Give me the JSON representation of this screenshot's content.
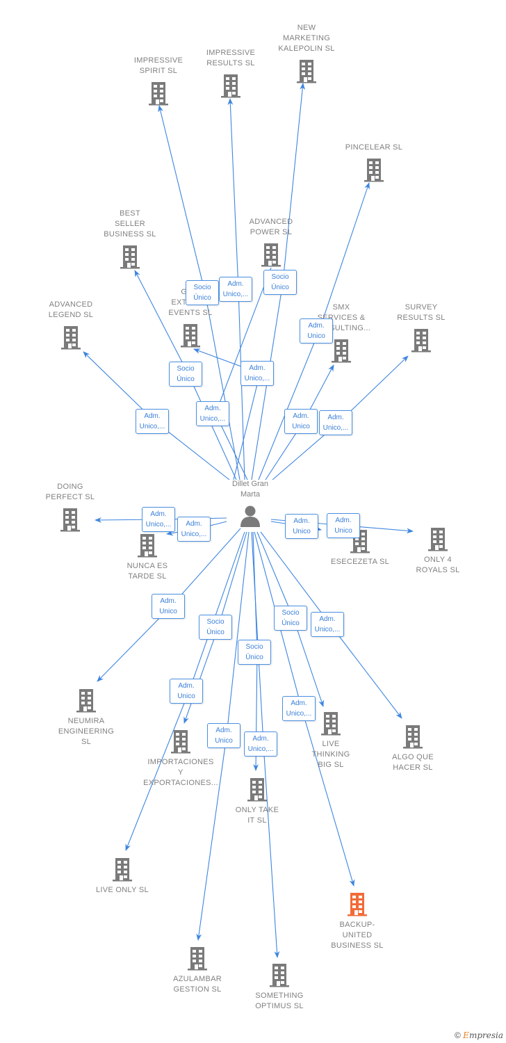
{
  "center": {
    "name": "Dillet Gran\nMarta",
    "icon": "person-icon"
  },
  "colors": {
    "edge": "#3d85e0",
    "building": "#7a7a7a",
    "highlight": "#f26b38",
    "label_text": "#808080"
  },
  "companies": [
    {
      "id": "impressive-spirit",
      "name": "IMPRESSIVE\nSPIRIT  SL",
      "role": "Socio\nÚnico"
    },
    {
      "id": "impressive-results",
      "name": "IMPRESSIVE\nRESULTS  SL",
      "role": "Adm.\nUnico,..."
    },
    {
      "id": "new-marketing",
      "name": "NEW\nMARKETING\nKALEPOLIN  SL",
      "role": "Socio\nÚnico"
    },
    {
      "id": "pincelear",
      "name": "PINCELEAR  SL",
      "role": "Adm.\nUnico"
    },
    {
      "id": "best-seller",
      "name": "BEST\nSELLER\nBUSINESS  SL",
      "role": "Socio\nÚnico"
    },
    {
      "id": "advanced-power",
      "name": "ADVANCED\nPOWER  SL",
      "role": "Adm.\nUnico,..."
    },
    {
      "id": "green-extreme",
      "name": "GR...\nEXTREME\nEVENTS  SL",
      "role": "Adm.\nUnico,..."
    },
    {
      "id": "advanced-legend",
      "name": "ADVANCED\nLEGEND  SL",
      "role": "Adm.\nUnico,..."
    },
    {
      "id": "smx",
      "name": "SMX\nSERVICES &\nCONSULTING...",
      "role": "Adm.\nUnico"
    },
    {
      "id": "survey-results",
      "name": "SURVEY\nRESULTS  SL",
      "role": "Adm.\nUnico,..."
    },
    {
      "id": "doing-perfect",
      "name": "DOING\nPERFECT  SL",
      "role": "Adm.\nUnico,..."
    },
    {
      "id": "nunca-es-tarde",
      "name": "NUNCA ES\nTARDE  SL",
      "role": "Adm.\nUnico,..."
    },
    {
      "id": "esecezeta",
      "name": "ESECEZETA SL",
      "role": "Adm.\nUnico"
    },
    {
      "id": "only-4-royals",
      "name": "ONLY 4\nROYALS  SL",
      "role": "Adm.\nUnico"
    },
    {
      "id": "neumira",
      "name": "NEUMIRA\nENGINEERING\nSL",
      "role": "Adm.\nUnico"
    },
    {
      "id": "importaciones",
      "name": "IMPORTACIONES\nY\nEXPORTACIONES...",
      "role": "Socio\nÚnico"
    },
    {
      "id": "live-only",
      "name": "LIVE ONLY  SL",
      "role": "Adm.\nUnico"
    },
    {
      "id": "azulambar",
      "name": "AZULAMBAR\nGESTION  SL",
      "role": "Adm.\nUnico"
    },
    {
      "id": "only-take-it",
      "name": "ONLY TAKE\nIT  SL",
      "role": "Socio\nÚnico"
    },
    {
      "id": "something-optimus",
      "name": "SOMETHING\nOPTIMUS  SL",
      "role": "Adm.\nUnico,..."
    },
    {
      "id": "live-thinking-big",
      "name": "LIVE\nTHINKING\nBIG  SL",
      "role": "Socio\nÚnico"
    },
    {
      "id": "backup-united",
      "name": "BACKUP-\nUNITED\nBUSINESS  SL",
      "role": "Adm.\nUnico,...",
      "highlight": true
    },
    {
      "id": "algo-que-hacer",
      "name": "ALGO QUE\nHACER  SL",
      "role": "Adm.\nUnico,..."
    }
  ],
  "footer": {
    "copyright": "©",
    "brand_first": "E",
    "brand_rest": "mpresia"
  }
}
